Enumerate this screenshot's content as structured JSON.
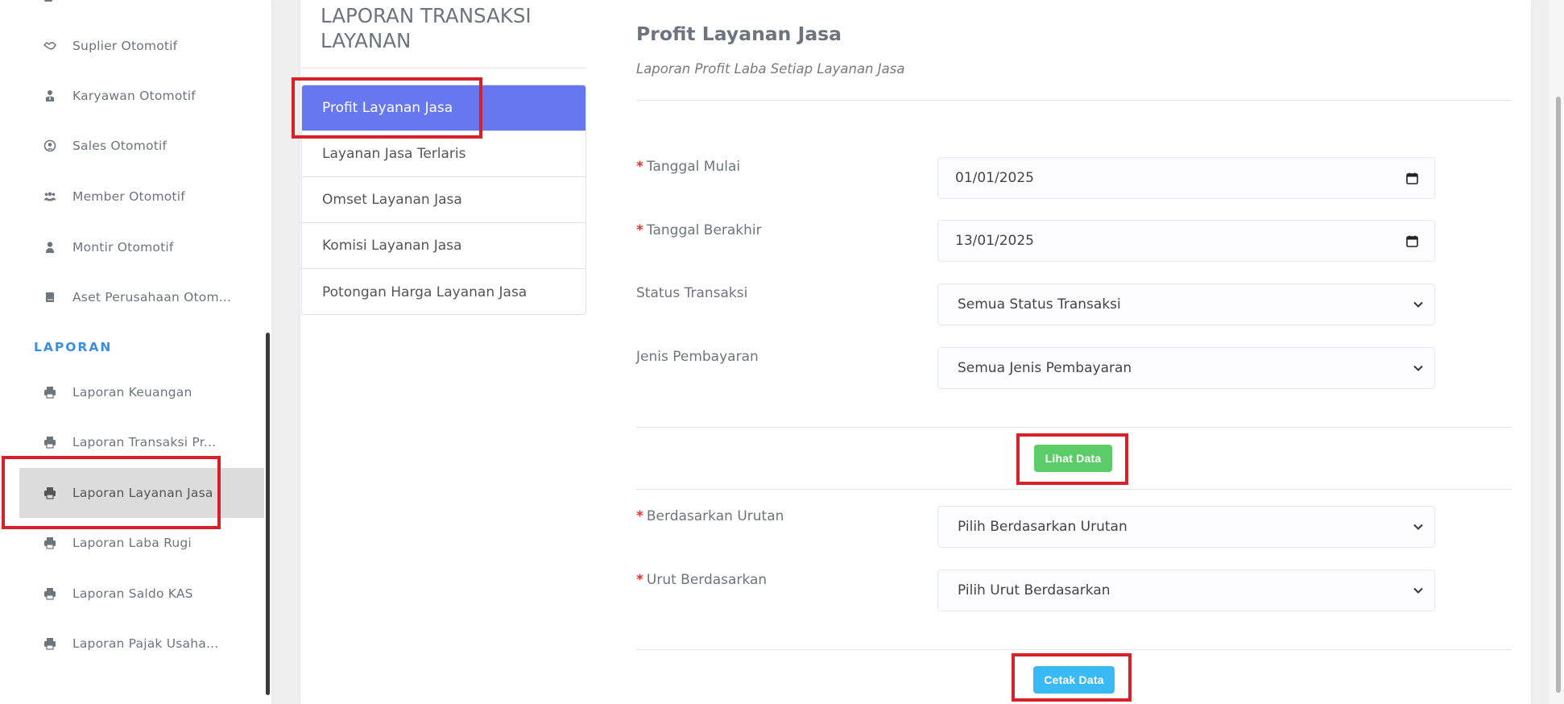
{
  "sidebar": {
    "items": [
      {
        "label": "Suplier Otomotif",
        "icon": "handshake-icon"
      },
      {
        "label": "Karyawan Otomotif",
        "icon": "user-tie-icon"
      },
      {
        "label": "Sales Otomotif",
        "icon": "user-circle-icon"
      },
      {
        "label": "Member Otomotif",
        "icon": "users-icon"
      },
      {
        "label": "Montir Otomotif",
        "icon": "user-icon"
      },
      {
        "label": "Aset Perusahaan Otom...",
        "icon": "book-icon"
      }
    ],
    "section_label": "LAPORAN",
    "report_items": [
      {
        "label": "Laporan Keuangan",
        "icon": "print-icon"
      },
      {
        "label": "Laporan Transaksi Pr...",
        "icon": "print-icon"
      },
      {
        "label": "Laporan Layanan Jasa",
        "icon": "print-icon",
        "active": true
      },
      {
        "label": "Laporan Laba Rugi",
        "icon": "print-icon"
      },
      {
        "label": "Laporan Saldo KAS",
        "icon": "print-icon"
      },
      {
        "label": "Laporan Pajak Usaha...",
        "icon": "print-icon"
      }
    ]
  },
  "submenu": {
    "title": "LAPORAN TRANSAKSI LAYANAN",
    "items": [
      {
        "label": "Profit Layanan Jasa",
        "active": true
      },
      {
        "label": "Layanan Jasa Terlaris"
      },
      {
        "label": "Omset Layanan Jasa"
      },
      {
        "label": "Komisi Layanan Jasa"
      },
      {
        "label": "Potongan Harga Layanan Jasa"
      }
    ]
  },
  "content": {
    "title": "Profit Layanan Jasa",
    "subtitle": "Laporan Profit Laba Setiap Layanan Jasa",
    "required_mark": "*",
    "fields": {
      "tanggal_mulai": {
        "label": "Tanggal Mulai",
        "value": "01/01/2025"
      },
      "tanggal_berakhir": {
        "label": "Tanggal Berakhir",
        "value": "13/01/2025"
      },
      "status_transaksi": {
        "label": "Status Transaksi",
        "value": "Semua Status Transaksi"
      },
      "jenis_pembayaran": {
        "label": "Jenis Pembayaran",
        "value": "Semua Jenis Pembayaran"
      },
      "berdasarkan_urutan": {
        "label": "Berdasarkan Urutan",
        "value": "Pilih Berdasarkan Urutan"
      },
      "urut_berdasarkan": {
        "label": "Urut Berdasarkan",
        "value": "Pilih Urut Berdasarkan"
      }
    },
    "lihat_button": "Lihat Data",
    "cetak_button": "Cetak Data"
  },
  "colors": {
    "accent": "#6777ef",
    "section_label": "#3b8fe3",
    "success": "#5ccc69",
    "info": "#3abaf4",
    "required": "#e3342f",
    "highlight": "#d6202a"
  }
}
